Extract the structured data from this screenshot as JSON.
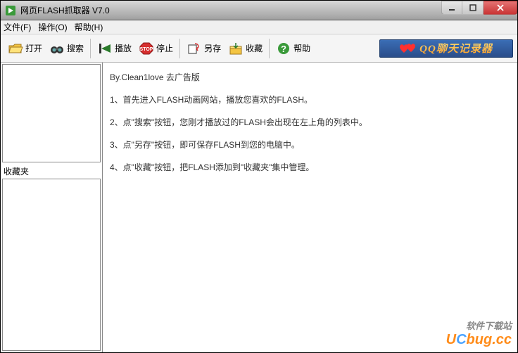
{
  "window": {
    "title": "网页FLASH抓取器 V7.0"
  },
  "menu": {
    "file": "文件(F)",
    "operate": "操作(O)",
    "help": "帮助(H)"
  },
  "toolbar": {
    "open": "打开",
    "search": "搜索",
    "play": "播放",
    "stop": "停止",
    "saveas": "另存",
    "favorite": "收藏",
    "help": "帮助"
  },
  "ad": {
    "text": "QQ聊天记录器"
  },
  "sidebar": {
    "favorites_label": "收藏夹"
  },
  "main": {
    "line0": "By.Clean1love 去广告版",
    "line1": "1、首先进入FLASH动画网站，播放您喜欢的FLASH。",
    "line2": "2、点\"搜索\"按钮，您刚才播放过的FLASH会出现在左上角的列表中。",
    "line3": "3、点\"另存\"按钮，即可保存FLASH到您的电脑中。",
    "line4": "4、点\"收藏\"按钮，把FLASH添加到\"收藏夹\"集中管理。"
  },
  "watermark": {
    "line1": "软件下载站",
    "line2_a": "U",
    "line2_b": "C",
    "line2_c": "bug.cc"
  }
}
